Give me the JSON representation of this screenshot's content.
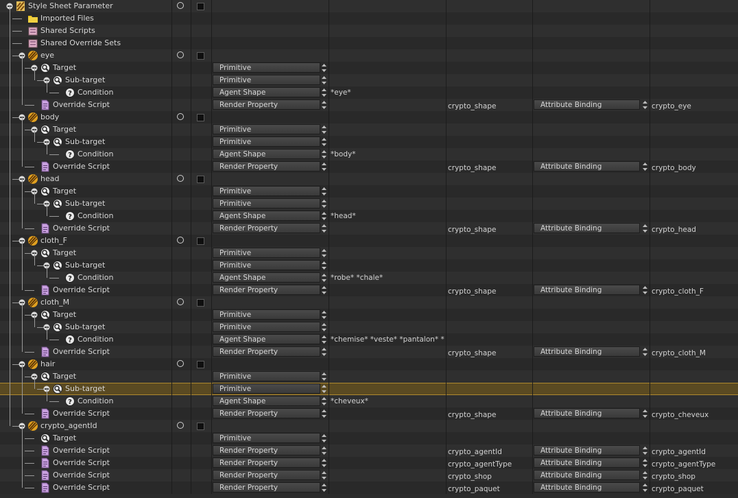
{
  "rows": [
    {
      "depth": 0,
      "kind": "root",
      "name": "Style Sheet Parameter",
      "toggles": true
    },
    {
      "depth": 1,
      "kind": "folder",
      "name": "Imported Files"
    },
    {
      "depth": 1,
      "kind": "shared",
      "name": "Shared Scripts"
    },
    {
      "depth": 1,
      "kind": "shared",
      "name": "Shared Override Sets"
    },
    {
      "depth": 1,
      "kind": "style",
      "name": "eye",
      "toggles": true
    },
    {
      "depth": 2,
      "kind": "target",
      "name": "Target",
      "combo": "Primitive"
    },
    {
      "depth": 3,
      "kind": "target",
      "name": "Sub-target",
      "combo": "Primitive"
    },
    {
      "depth": 4,
      "kind": "condition",
      "name": "Condition",
      "combo": "Agent Shape",
      "value": "*eye*"
    },
    {
      "depth": 2,
      "kind": "script",
      "name": "Override Script",
      "combo": "Render Property",
      "prop": "crypto_shape",
      "binding": "Attribute Binding",
      "bindval": "crypto_eye"
    },
    {
      "depth": 1,
      "kind": "style",
      "name": "body",
      "toggles": true
    },
    {
      "depth": 2,
      "kind": "target",
      "name": "Target",
      "combo": "Primitive"
    },
    {
      "depth": 3,
      "kind": "target",
      "name": "Sub-target",
      "combo": "Primitive"
    },
    {
      "depth": 4,
      "kind": "condition",
      "name": "Condition",
      "combo": "Agent Shape",
      "value": "*body*"
    },
    {
      "depth": 2,
      "kind": "script",
      "name": "Override Script",
      "combo": "Render Property",
      "prop": "crypto_shape",
      "binding": "Attribute Binding",
      "bindval": "crypto_body"
    },
    {
      "depth": 1,
      "kind": "style",
      "name": "head",
      "toggles": true
    },
    {
      "depth": 2,
      "kind": "target",
      "name": "Target",
      "combo": "Primitive"
    },
    {
      "depth": 3,
      "kind": "target",
      "name": "Sub-target",
      "combo": "Primitive"
    },
    {
      "depth": 4,
      "kind": "condition",
      "name": "Condition",
      "combo": "Agent Shape",
      "value": "*head*"
    },
    {
      "depth": 2,
      "kind": "script",
      "name": "Override Script",
      "combo": "Render Property",
      "prop": "crypto_shape",
      "binding": "Attribute Binding",
      "bindval": "crypto_head"
    },
    {
      "depth": 1,
      "kind": "style",
      "name": "cloth_F",
      "toggles": true
    },
    {
      "depth": 2,
      "kind": "target",
      "name": "Target",
      "combo": "Primitive"
    },
    {
      "depth": 3,
      "kind": "target",
      "name": "Sub-target",
      "combo": "Primitive"
    },
    {
      "depth": 4,
      "kind": "condition",
      "name": "Condition",
      "combo": "Agent Shape",
      "value": "*robe* *chale*"
    },
    {
      "depth": 2,
      "kind": "script",
      "name": "Override Script",
      "combo": "Render Property",
      "prop": "crypto_shape",
      "binding": "Attribute Binding",
      "bindval": "crypto_cloth_F"
    },
    {
      "depth": 1,
      "kind": "style",
      "name": "cloth_M",
      "toggles": true
    },
    {
      "depth": 2,
      "kind": "target",
      "name": "Target",
      "combo": "Primitive"
    },
    {
      "depth": 3,
      "kind": "target",
      "name": "Sub-target",
      "combo": "Primitive"
    },
    {
      "depth": 4,
      "kind": "condition",
      "name": "Condition",
      "combo": "Agent Shape",
      "value": "*chemise* *veste* *pantalon* *cr"
    },
    {
      "depth": 2,
      "kind": "script",
      "name": "Override Script",
      "combo": "Render Property",
      "prop": "crypto_shape",
      "binding": "Attribute Binding",
      "bindval": "crypto_cloth_M"
    },
    {
      "depth": 1,
      "kind": "style",
      "name": "hair",
      "toggles": true
    },
    {
      "depth": 2,
      "kind": "target",
      "name": "Target",
      "combo": "Primitive"
    },
    {
      "depth": 3,
      "kind": "target",
      "name": "Sub-target",
      "combo": "Primitive",
      "selected": true
    },
    {
      "depth": 4,
      "kind": "condition",
      "name": "Condition",
      "combo": "Agent Shape",
      "value": "*cheveux*"
    },
    {
      "depth": 2,
      "kind": "script",
      "name": "Override Script",
      "combo": "Render Property",
      "prop": "crypto_shape",
      "binding": "Attribute Binding",
      "bindval": "crypto_cheveux"
    },
    {
      "depth": 1,
      "kind": "style",
      "name": "crypto_agentId",
      "toggles": true
    },
    {
      "depth": 2,
      "kind": "target",
      "name": "Target",
      "combo": "Primitive",
      "leaf": true
    },
    {
      "depth": 2,
      "kind": "script",
      "name": "Override Script",
      "combo": "Render Property",
      "prop": "crypto_agentId",
      "binding": "Attribute Binding",
      "bindval": "crypto_agentId"
    },
    {
      "depth": 2,
      "kind": "script",
      "name": "Override Script",
      "combo": "Render Property",
      "prop": "crypto_agentType",
      "binding": "Attribute Binding",
      "bindval": "crypto_agentType"
    },
    {
      "depth": 2,
      "kind": "script",
      "name": "Override Script",
      "combo": "Render Property",
      "prop": "crypto_shop",
      "binding": "Attribute Binding",
      "bindval": "crypto_shop"
    },
    {
      "depth": 2,
      "kind": "script",
      "name": "Override Script",
      "combo": "Render Property",
      "prop": "crypto_paquet",
      "binding": "Attribute Binding",
      "bindval": "crypto_paquet"
    }
  ],
  "colors": {
    "selection_border": "#b08a2e",
    "style_icon": "#e0a020",
    "folder_icon": "#e8c020",
    "script_icon": "#c9a0e0"
  }
}
